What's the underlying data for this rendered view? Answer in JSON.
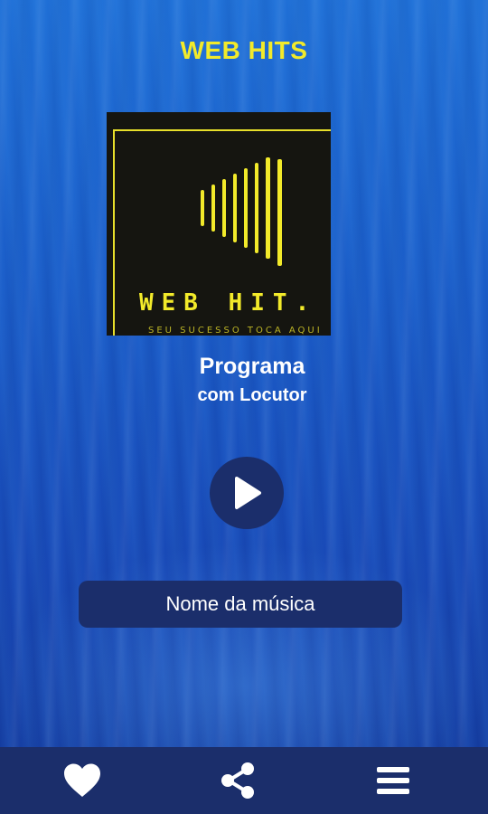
{
  "header": {
    "title": "WEB HITS"
  },
  "cover": {
    "brand_text": "WEB HIT.",
    "tagline_text": "SEU SUCESSO TOCA AQUI",
    "accent_color": "#f2ea2a"
  },
  "program": {
    "title": "Programa",
    "host": "com Locutor"
  },
  "player": {
    "play_icon": "play-icon",
    "now_playing": "Nome da música"
  },
  "bottom_bar": {
    "favorite_icon": "heart-icon",
    "share_icon": "share-icon",
    "menu_icon": "menu-icon"
  },
  "colors": {
    "panel": "#1b2e6b",
    "title_yellow": "#f2ea2a"
  }
}
